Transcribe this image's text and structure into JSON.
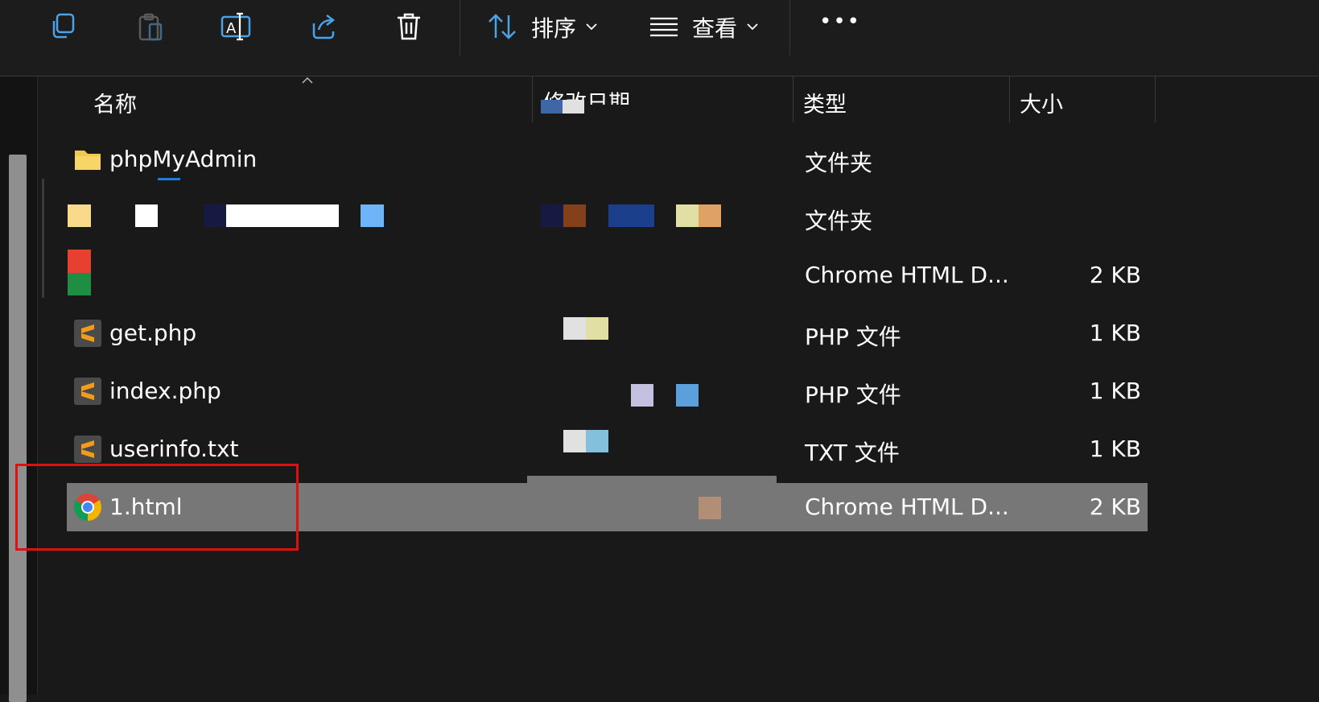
{
  "toolbar": {
    "sort_label": "排序",
    "view_label": "查看",
    "more_label": "•••",
    "icons": [
      "copy-icon",
      "paste-icon",
      "rename-icon",
      "share-icon",
      "delete-icon",
      "sort-icon",
      "view-icon",
      "more-icon"
    ]
  },
  "columns": {
    "name": "名称",
    "modified": "修改日期",
    "type": "类型",
    "size": "大小"
  },
  "files": [
    {
      "name": "phpMyAdmin",
      "type": "文件夹",
      "size": "",
      "icon": "folder-icon"
    },
    {
      "name": "",
      "type": "文件夹",
      "size": "",
      "icon": "folder-icon"
    },
    {
      "name": "",
      "type": "Chrome HTML D...",
      "size": "2 KB",
      "icon": "chrome-icon"
    },
    {
      "name": "get.php",
      "type": "PHP 文件",
      "size": "1 KB",
      "icon": "sublime-icon"
    },
    {
      "name": "index.php",
      "type": "PHP 文件",
      "size": "1 KB",
      "icon": "sublime-icon"
    },
    {
      "name": "userinfo.txt",
      "type": "TXT 文件",
      "size": "1 KB",
      "icon": "sublime-icon"
    },
    {
      "name": "1.html",
      "type": "Chrome HTML D...",
      "size": "2 KB",
      "icon": "chrome-icon",
      "selected": true
    }
  ],
  "colors": {
    "background": "#191919",
    "selection": "#777777",
    "accent": "#4aa3e8",
    "highlight_box": "#e01010",
    "folder": "#f2c94c",
    "sublime": "#f59b1c"
  }
}
